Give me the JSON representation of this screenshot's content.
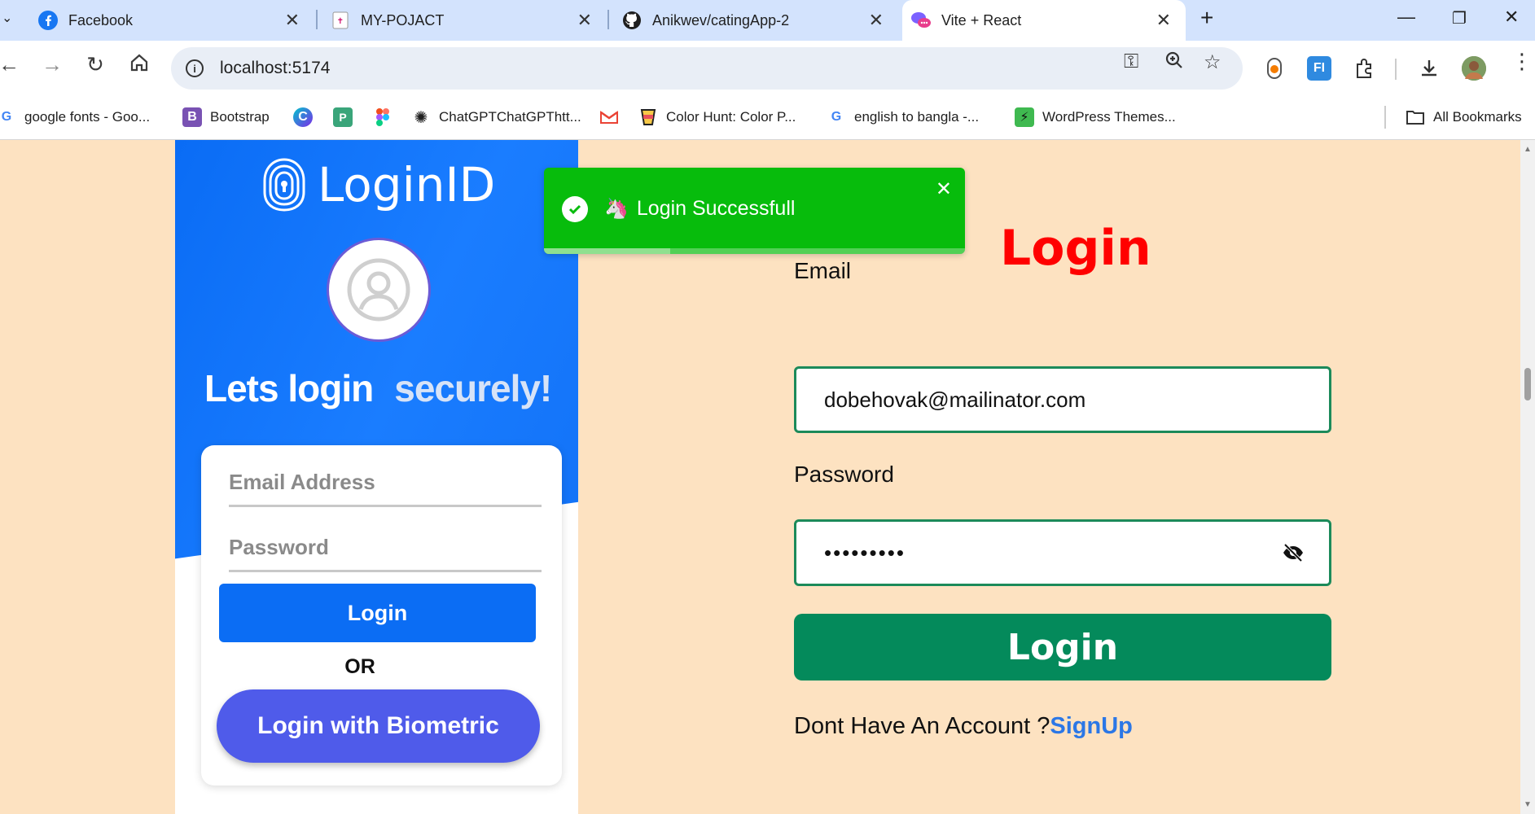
{
  "browser": {
    "tabs": [
      {
        "title": "Facebook",
        "icon": "facebook-icon"
      },
      {
        "title": "MY-POJACT",
        "icon": "page-icon"
      },
      {
        "title": "Anikwev/catingApp-2",
        "icon": "github-icon"
      },
      {
        "title": "Vite + React",
        "icon": "chat-bubbles-icon",
        "active": true
      }
    ],
    "url": "localhost:5174",
    "bookmarks": [
      {
        "label": "google fonts - Goo...",
        "icon": "google-icon"
      },
      {
        "label": "Bootstrap",
        "icon": "bootstrap-icon"
      },
      {
        "label": "",
        "icon": "canva-icon"
      },
      {
        "label": "",
        "icon": "p-icon"
      },
      {
        "label": "",
        "icon": "figma-icon"
      },
      {
        "label": "ChatGPTChatGPThtt...",
        "icon": "openai-icon"
      },
      {
        "label": "",
        "icon": "gmail-icon"
      },
      {
        "label": "Color Hunt: Color P...",
        "icon": "colorhunt-icon"
      },
      {
        "label": "english to bangla -...",
        "icon": "google-icon"
      },
      {
        "label": "WordPress Themes...",
        "icon": "wordpress-icon"
      }
    ],
    "all_bookmarks": "All Bookmarks"
  },
  "left_panel": {
    "logo_text": "LoginID",
    "headline_1": "Lets login",
    "headline_2": "securely!",
    "email_placeholder": "Email Address",
    "password_placeholder": "Password",
    "login_button": "Login",
    "or_text": "OR",
    "biometric_button": "Login with Biometric"
  },
  "toast": {
    "emoji": "🦄",
    "message": "Login Successfull",
    "progress": 0.3,
    "color": "#07bc0c"
  },
  "login_form": {
    "title": "Login",
    "email_label": "Email",
    "email_value": "dobehovak@mailinator.com",
    "password_label": "Password",
    "password_value": "•••••••••",
    "submit_label": "Login",
    "footer_text": "Dont Have An Account ?",
    "signup_link": "SignUp",
    "title_color": "#ff0000",
    "button_color": "#048a5b",
    "background_color": "#fde2c1"
  }
}
